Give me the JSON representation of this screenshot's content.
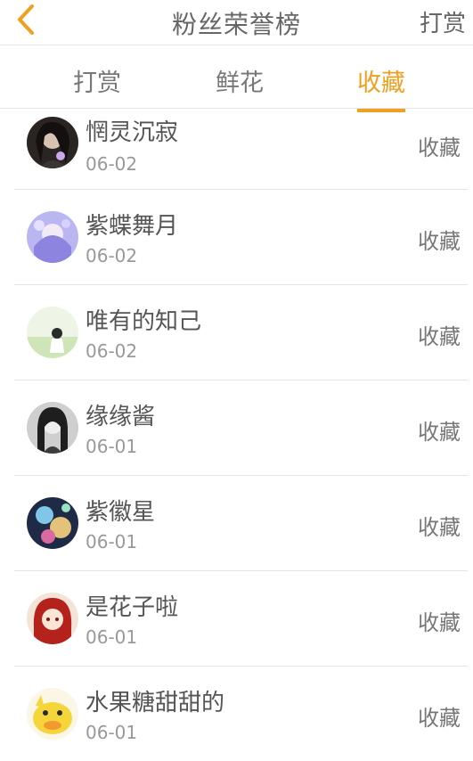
{
  "header": {
    "back_icon": "chevron-left-icon",
    "title": "粉丝荣誉榜",
    "action_label": "打赏"
  },
  "tabs": [
    {
      "label": "打赏",
      "active": false
    },
    {
      "label": "鲜花",
      "active": false
    },
    {
      "label": "收藏",
      "active": true
    }
  ],
  "colors": {
    "accent": "#f0a020",
    "text": "#555555",
    "muted": "#999999",
    "divider": "#e4e4e4"
  },
  "fans": [
    {
      "name": "惘灵沉寂",
      "date": "06-02",
      "action": "收藏"
    },
    {
      "name": "紫蝶舞月",
      "date": "06-02",
      "action": "收藏"
    },
    {
      "name": "唯有的知己",
      "date": "06-02",
      "action": "收藏"
    },
    {
      "name": "缘缘酱",
      "date": "06-01",
      "action": "收藏"
    },
    {
      "name": "紫徽星",
      "date": "06-01",
      "action": "收藏"
    },
    {
      "name": "是花子啦",
      "date": "06-01",
      "action": "收藏"
    },
    {
      "name": "水果糖甜甜的",
      "date": "06-01",
      "action": "收藏"
    }
  ]
}
